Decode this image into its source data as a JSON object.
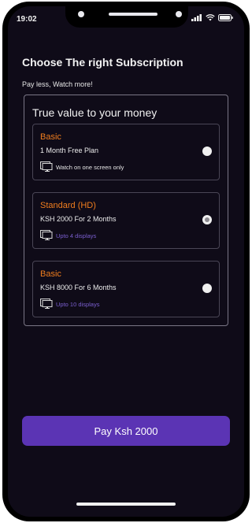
{
  "status_bar": {
    "time": "19:02"
  },
  "page": {
    "title": "Choose The right Subscription",
    "subtitle": "Pay less, Watch more!"
  },
  "card": {
    "title": "True value to your money",
    "plans": [
      {
        "name": "Basic",
        "price": "1 Month Free Plan",
        "feature": "Watch on one screen only",
        "selected": false
      },
      {
        "name": "Standard (HD)",
        "price": "KSH 2000 For 2 Months",
        "feature": "Upto 4 displays",
        "selected": true
      },
      {
        "name": "Basic",
        "price": "KSH 8000 For 6 Months",
        "feature": "Upto 10 displays",
        "selected": false
      }
    ]
  },
  "pay_button": {
    "label": "Pay Ksh 2000"
  },
  "colors": {
    "background": "#0f0b18",
    "plan_name": "#f07d1e",
    "feature_accent": "#7b5fd0",
    "button": "#5b34b4"
  },
  "icons": {
    "feature": "monitor-icon",
    "status": [
      "cellular-signal-icon",
      "wifi-icon",
      "battery-icon"
    ]
  }
}
